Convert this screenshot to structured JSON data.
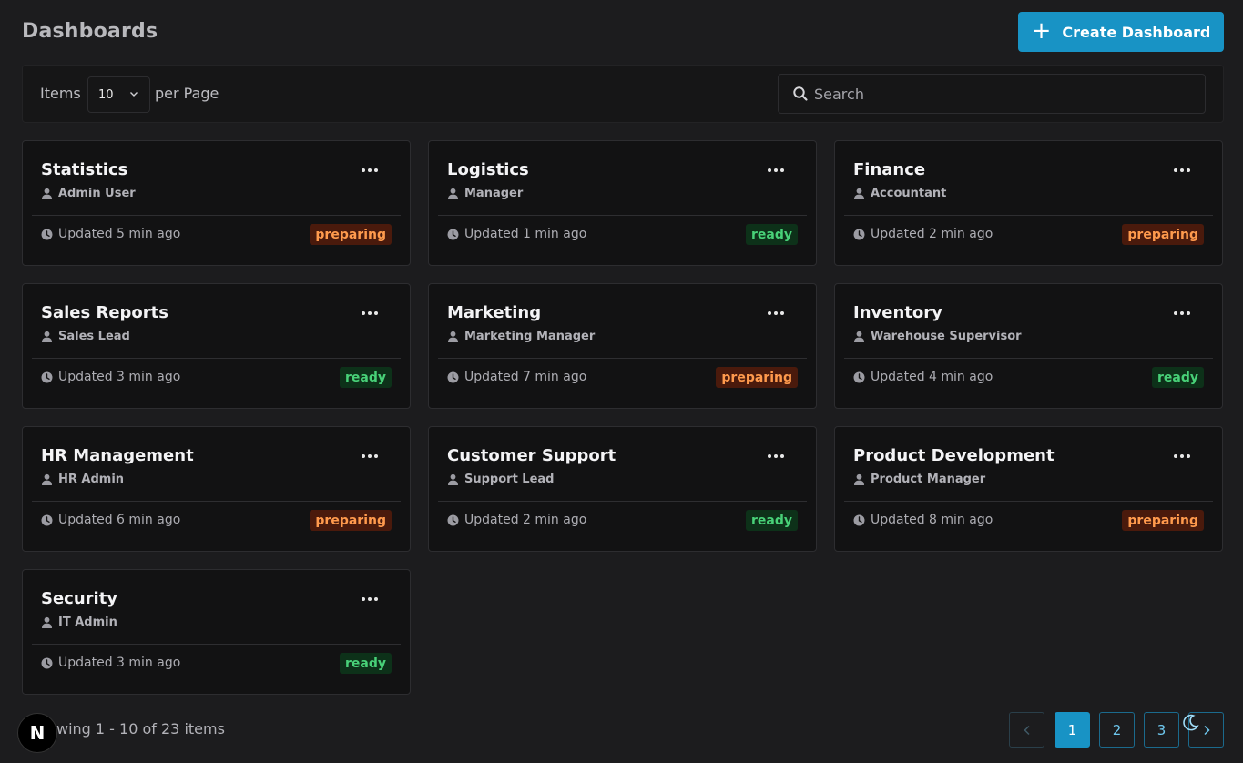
{
  "header": {
    "title": "Dashboards",
    "create_label": "Create Dashboard",
    "create_icon": "plus-icon"
  },
  "toolbar": {
    "items_label": "Items",
    "per_page_value": "10",
    "per_page_label": "per Page",
    "search_placeholder": "Search",
    "search_value": ""
  },
  "cards": [
    {
      "title": "Statistics",
      "owner": "Admin User",
      "updated": "Updated 5 min ago",
      "status": "preparing"
    },
    {
      "title": "Logistics",
      "owner": "Manager",
      "updated": "Updated 1 min ago",
      "status": "ready"
    },
    {
      "title": "Finance",
      "owner": "Accountant",
      "updated": "Updated 2 min ago",
      "status": "preparing"
    },
    {
      "title": "Sales Reports",
      "owner": "Sales Lead",
      "updated": "Updated 3 min ago",
      "status": "ready"
    },
    {
      "title": "Marketing",
      "owner": "Marketing Manager",
      "updated": "Updated 7 min ago",
      "status": "preparing"
    },
    {
      "title": "Inventory",
      "owner": "Warehouse Supervisor",
      "updated": "Updated 4 min ago",
      "status": "ready"
    },
    {
      "title": "HR Management",
      "owner": "HR Admin",
      "updated": "Updated 6 min ago",
      "status": "preparing"
    },
    {
      "title": "Customer Support",
      "owner": "Support Lead",
      "updated": "Updated 2 min ago",
      "status": "ready"
    },
    {
      "title": "Product Development",
      "owner": "Product Manager",
      "updated": "Updated 8 min ago",
      "status": "preparing"
    },
    {
      "title": "Security",
      "owner": "IT Admin",
      "updated": "Updated 3 min ago",
      "status": "ready"
    }
  ],
  "footer": {
    "showing": "wing 1 - 10 of 23 items",
    "logo_letter": "N",
    "pages": [
      "1",
      "2",
      "3"
    ],
    "current_page": "1"
  },
  "colors": {
    "accent": "#1893c5",
    "preparing_bg": "#4a1a0c",
    "preparing_fg": "#ff9a4d",
    "ready_bg": "#0d3119",
    "ready_fg": "#48d178"
  }
}
